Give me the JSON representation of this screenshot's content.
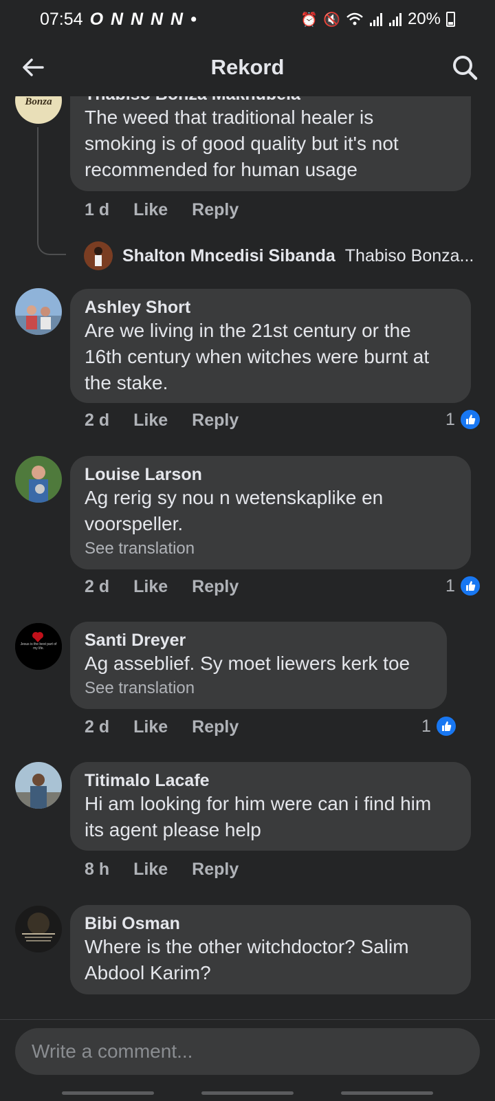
{
  "status_bar": {
    "time": "07:54",
    "notifications": "O N N N N •",
    "battery": "20%",
    "icons": [
      "alarm-icon",
      "mute-icon",
      "wifi-icon",
      "signal-icon",
      "signal-icon-2",
      "battery-icon"
    ]
  },
  "header": {
    "title": "Rekord",
    "back_icon": "arrow-left-icon",
    "search_icon": "search-icon"
  },
  "colors": {
    "background": "#242526",
    "bubble": "#3a3b3c",
    "text": "#e4e6eb",
    "secondary_text": "#b0b3b8",
    "like_blue": "#1877f2"
  },
  "comments": [
    {
      "author": "Thabiso Bonza Makhubela",
      "avatar_text": "Bonza",
      "lines": [
        "The weed that traditional healer is",
        "smoking is of good quality but it's not",
        "recommended for human usage"
      ],
      "time": "1 d",
      "like": "Like",
      "reply": "Reply",
      "reply_preview": {
        "author": "Shalton Mncedisi Sibanda",
        "text": "Thabiso Bonza..."
      }
    },
    {
      "author": "Ashley Short",
      "lines": [
        "Are we living in the 21st century or the",
        "16th century when witches were burnt at",
        "the stake."
      ],
      "time": "2 d",
      "like": "Like",
      "reply": "Reply",
      "reaction_count": "1"
    },
    {
      "author": "Louise Larson",
      "lines": [
        "Ag rerig sy nou n wetenskaplike en",
        "voorspeller."
      ],
      "see_translation": "See translation",
      "time": "2 d",
      "like": "Like",
      "reply": "Reply",
      "reaction_count": "1"
    },
    {
      "author": "Santi Dreyer",
      "avatar_text": "Jesus is the best part of my life.",
      "lines": [
        "Ag asseblief. Sy moet liewers kerk toe"
      ],
      "see_translation": "See translation",
      "time": "2 d",
      "like": "Like",
      "reply": "Reply",
      "reaction_count": "1"
    },
    {
      "author": "Titimalo Lacafe",
      "lines": [
        "Hi am looking for him were can i find him",
        "its agent please help"
      ],
      "time": "8 h",
      "like": "Like",
      "reply": "Reply"
    },
    {
      "author": "Bibi Osman",
      "lines": [
        "Where is the other witchdoctor? Salim",
        "Abdool Karim?"
      ]
    }
  ],
  "composer": {
    "placeholder": "Write a comment..."
  }
}
